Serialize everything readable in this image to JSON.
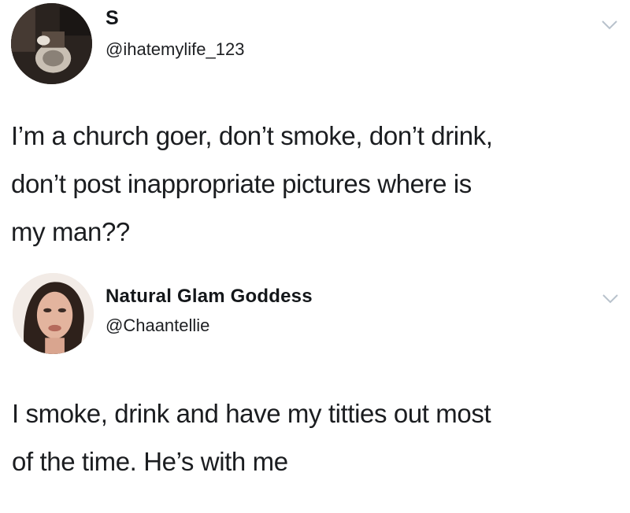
{
  "tweets": [
    {
      "display_name": "S",
      "handle": "@ihatemylife_123",
      "text": "I’m a church goer, don’t smoke, don’t drink,\ndon’t post inappropriate pictures where is\nmy man??",
      "menu_icon": "chevron-down-icon"
    },
    {
      "display_name": "Natural Glam Goddess",
      "handle": "@Chaantellie",
      "text": "I smoke, drink and have my titties out most\nof the time. He’s with me",
      "menu_icon": "chevron-down-icon"
    }
  ],
  "colors": {
    "text": "#14171a",
    "chevron": "#b8c2cc",
    "background": "#ffffff"
  }
}
